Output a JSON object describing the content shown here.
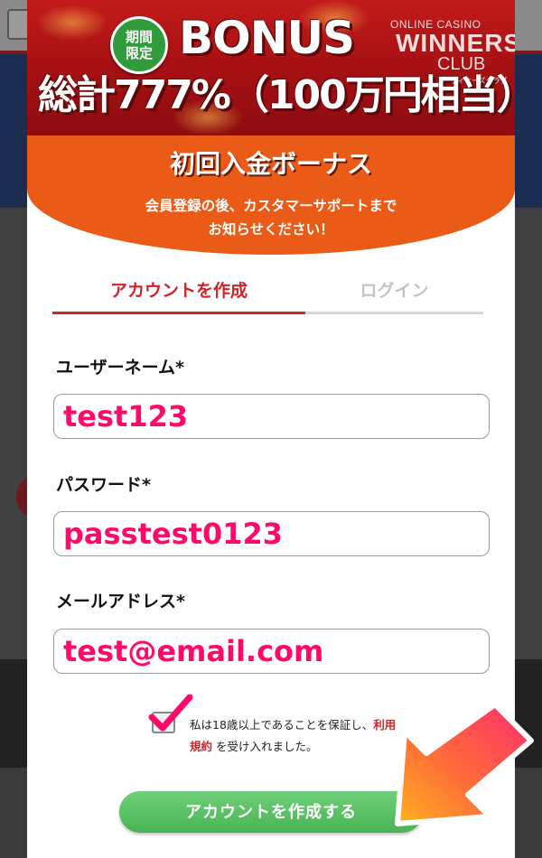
{
  "banner": {
    "badge_line1": "期間",
    "badge_line2": "限定",
    "bonus_title": "BONUS",
    "bonus_total": "総計777%（100万円相当）",
    "logo_line1": "ONLINE CASINO",
    "logo_line2": "WINNERS",
    "logo_line3": "CLUB",
    "logo_line4": "ウィナーズクラブ"
  },
  "deposit": {
    "title": "初回入金ボーナス",
    "note_line1": "会員登録の後、カスタマーサポートまで",
    "note_line2": "お知らせください！"
  },
  "tabs": {
    "create": "アカウントを作成",
    "login": "ログイン"
  },
  "form": {
    "username_label": "ユーザーネーム*",
    "username_value": "test123",
    "password_label": "パスワード*",
    "password_value": "passtest0123",
    "email_label": "メールアドレス*",
    "email_value": "test@email.com"
  },
  "terms": {
    "text_before": "私は18歳以上であることを保証し、",
    "link": "利用規約",
    "text_after": " を受け入れました。"
  },
  "submit": {
    "label": "アカウントを作成する"
  },
  "colors": {
    "accent_red": "#d1232a",
    "input_text": "#ff0a6a",
    "submit_green": "#49b454",
    "banner_orange": "#ea5b18"
  }
}
